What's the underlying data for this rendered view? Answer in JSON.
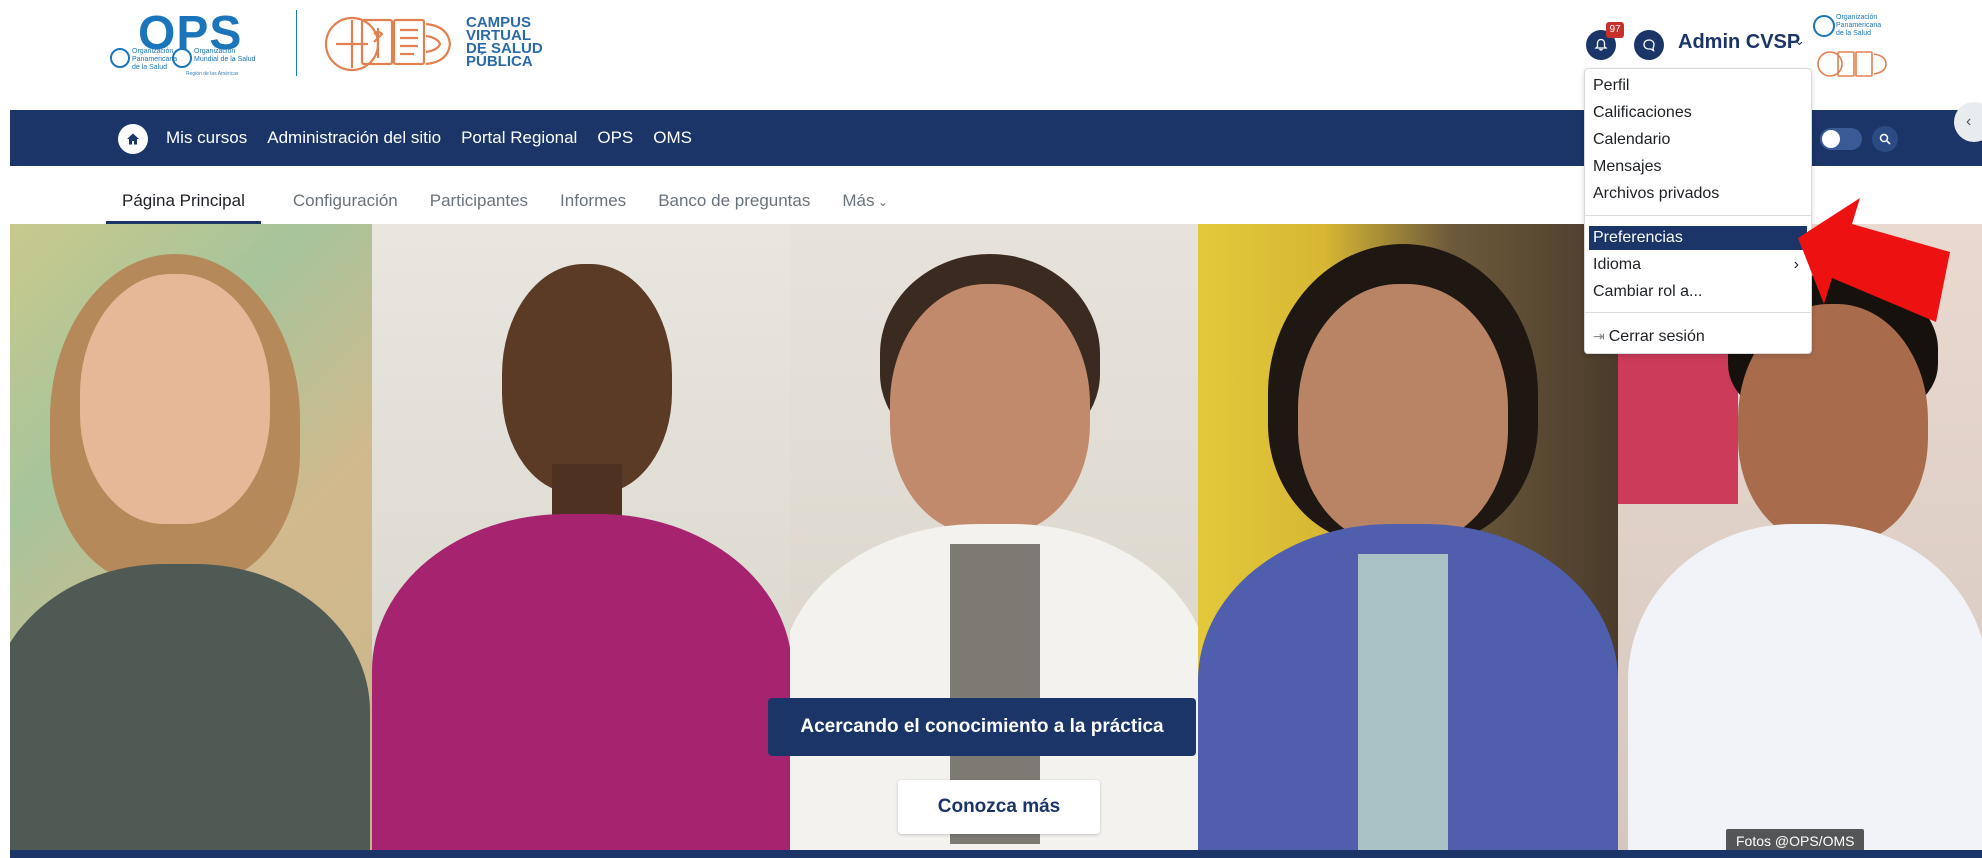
{
  "header": {
    "ops_logo": {
      "word": "OPS",
      "left_caption": "Organización\nPanamericana\nde la Salud",
      "right_caption": "Organización\nMundial de la Salud",
      "region": "Región de las Américas"
    },
    "campus_logo": {
      "text": "CAMPUS\nVIRTUAL\nDE SALUD\nPÚBLICA"
    },
    "notifications_badge": "97",
    "user_name": "Admin CVSP",
    "org_logo_text": "Organización\nPanamericana\nde la Salud"
  },
  "navbar": {
    "items": [
      {
        "label": "Mis cursos"
      },
      {
        "label": "Administración del sitio"
      },
      {
        "label": "Portal Regional"
      },
      {
        "label": "OPS"
      },
      {
        "label": "OMS"
      }
    ]
  },
  "secondary_nav": {
    "items": [
      {
        "label": "Página Principal"
      },
      {
        "label": "Configuración"
      },
      {
        "label": "Participantes"
      },
      {
        "label": "Informes"
      },
      {
        "label": "Banco de preguntas"
      }
    ],
    "more_label": "Más"
  },
  "hero": {
    "tagline": "Acercando el conocimiento a la práctica",
    "cta_label": "Conozca más",
    "photo_credit": "Fotos @OPS/OMS"
  },
  "user_menu": {
    "items": [
      {
        "label": "Perfil"
      },
      {
        "label": "Calificaciones"
      },
      {
        "label": "Calendario"
      },
      {
        "label": "Mensajes"
      },
      {
        "label": "Archivos privados"
      },
      {
        "label": "Preferencias"
      },
      {
        "label": "Idioma"
      },
      {
        "label": "Cambiar rol a..."
      },
      {
        "label": "Cerrar sesión"
      }
    ],
    "selected": "Preferencias"
  },
  "colors": {
    "brand_navy": "#1b3569",
    "ops_blue": "#1a75bb",
    "badge_red": "#c9302c",
    "arrow_red": "#ee1111"
  },
  "icons": [
    "home-icon",
    "bell-icon",
    "chat-icon",
    "chevron-down-icon",
    "search-icon",
    "chevron-left-icon",
    "chevron-right-icon",
    "logout-icon"
  ]
}
